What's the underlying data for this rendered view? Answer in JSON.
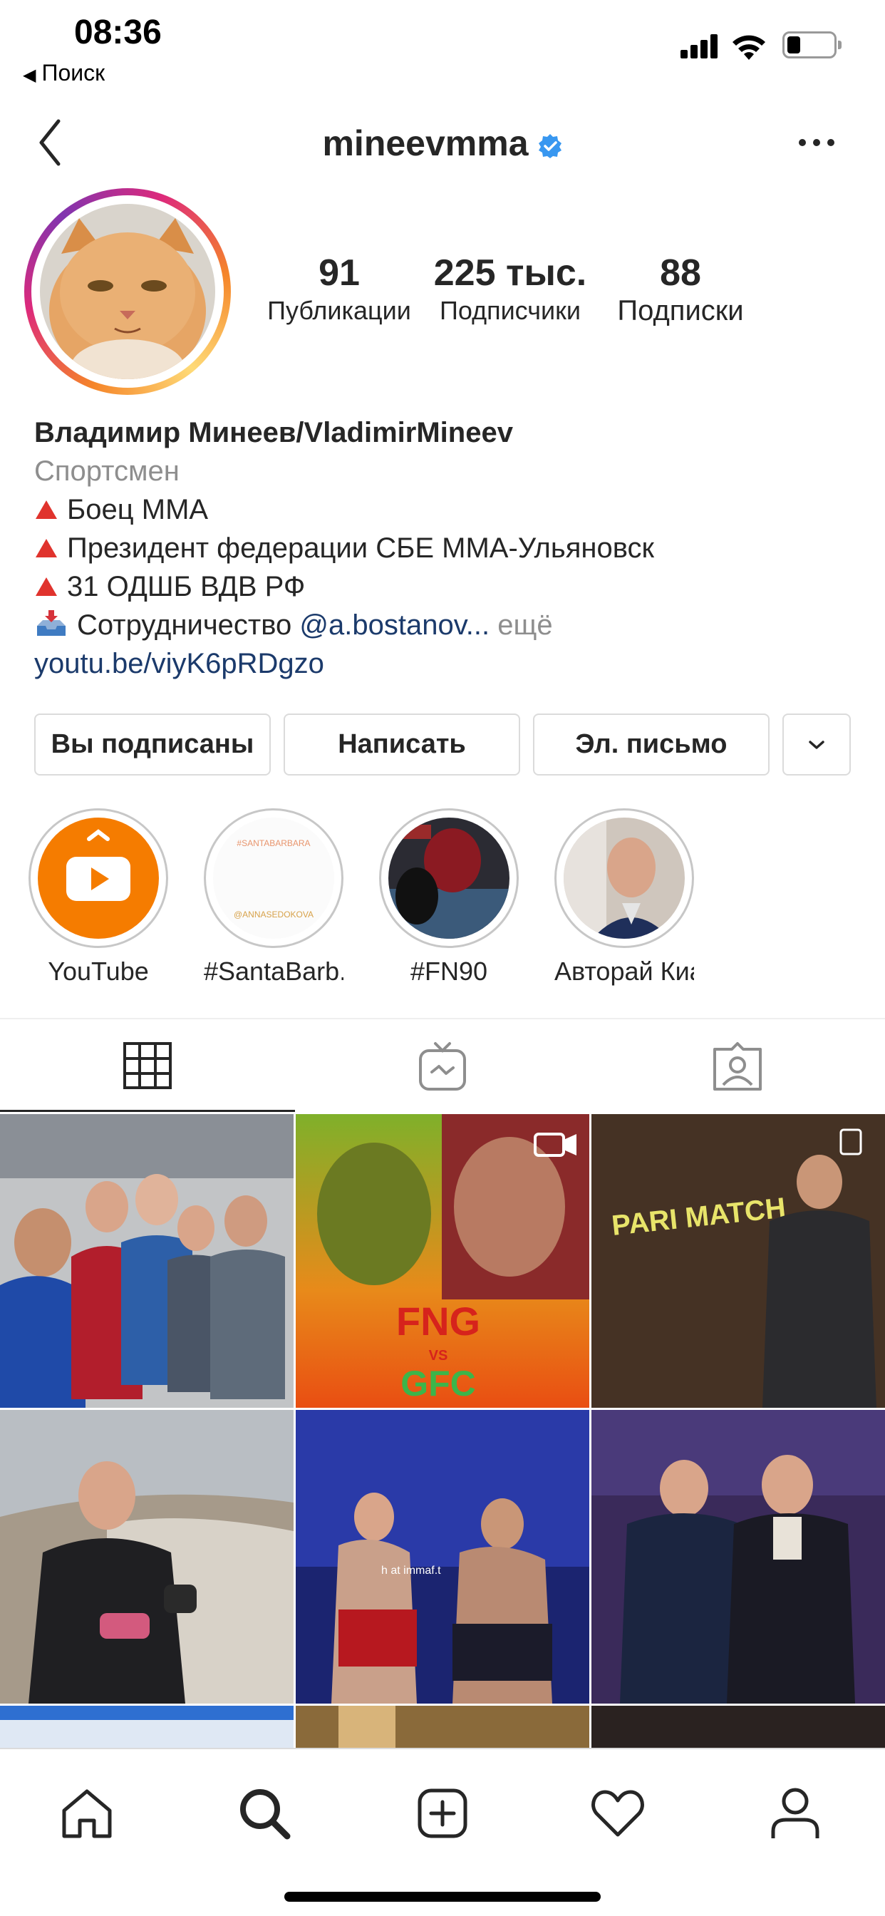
{
  "status_bar": {
    "time": "08:36",
    "back_app": "Поиск"
  },
  "header": {
    "username": "mineevmma",
    "verified": true
  },
  "stats": {
    "posts": {
      "value": "91",
      "label": "Публикации"
    },
    "followers": {
      "value": "225 тыс.",
      "label": "Подписчики"
    },
    "following": {
      "value": "88",
      "label": "Подписки"
    }
  },
  "bio": {
    "name": "Владимир Минеев/VladimirMineev",
    "category": "Спортсмен",
    "lines": [
      "Боец ММА",
      "Президент федерации СБЕ ММА-Ульяновск",
      "31 ОДШБ ВДВ РФ"
    ],
    "cooperation_text": "Сотрудничество",
    "mention": "@a.bostanov...",
    "more": "ещё",
    "link": "youtu.be/viyK6pRDgzo"
  },
  "buttons": {
    "following": "Вы подписаны",
    "message": "Написать",
    "email": "Эл. письмо"
  },
  "highlights": [
    {
      "label": "YouTube"
    },
    {
      "label": "#SantaBarb..."
    },
    {
      "label": "#FN90"
    },
    {
      "label": "Авторай Киа"
    }
  ],
  "highlight_texts": {
    "santa_top": "#SANTABARBARA",
    "santa_bottom": "@ANNASEDOKOVA"
  },
  "grid_texts": {
    "fng": "FNG",
    "vs": "VS",
    "gfc": "GFC",
    "pari": "PARI MATCH",
    "immaf": "h at immaf.t"
  },
  "colors": {
    "accent": "#3897f0",
    "link": "#1b3a6b",
    "youtube_orange": "#f57c00",
    "text": "#262626",
    "secondary": "#8e8e8e"
  },
  "icons": [
    "back-chevron-icon",
    "verified-badge-icon",
    "more-dots-icon",
    "chevron-down-icon",
    "grid-icon",
    "igtv-icon",
    "tagged-icon",
    "home-icon",
    "search-icon",
    "add-post-icon",
    "heart-icon",
    "profile-icon"
  ]
}
